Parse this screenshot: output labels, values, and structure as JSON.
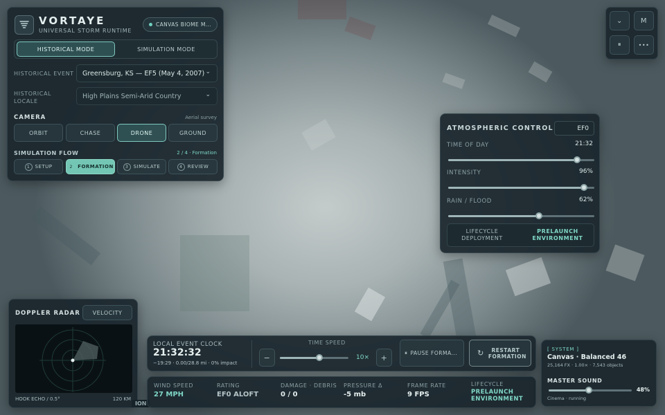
{
  "app": {
    "name": "VORTAYE",
    "subtitle": "UNIVERSAL STORM RUNTIME",
    "badge": "CANVAS BIOME M..."
  },
  "modes": {
    "historical": "HISTORICAL MODE",
    "simulation": "SIMULATION MODE"
  },
  "event": {
    "label": "HISTORICAL EVENT",
    "value": "Greensburg, KS — EF5 (May 4, 2007)"
  },
  "locale": {
    "label1": "HISTORICAL",
    "label2": "LOCALE",
    "value": "High Plains Semi-Arid Country"
  },
  "camera": {
    "title": "CAMERA",
    "hint": "Aerial survey",
    "options": [
      "ORBIT",
      "CHASE",
      "DRONE",
      "GROUND"
    ],
    "active": "DRONE"
  },
  "flow": {
    "title": "SIMULATION FLOW",
    "progress": "2 / 4 · Formation",
    "steps": [
      {
        "num": "1",
        "label": "SETUP"
      },
      {
        "num": "2",
        "label": "FORMATION"
      },
      {
        "num": "3",
        "label": "SIMULATE"
      },
      {
        "num": "4",
        "label": "REVIEW"
      }
    ],
    "active_step": "2"
  },
  "topright": {
    "collapse": "⌄",
    "m": "M",
    "pause": "⏸",
    "more": "•••"
  },
  "atmos": {
    "title": "ATMOSPHERIC CONTROL",
    "badge": "EF0",
    "time": {
      "label": "TIME OF DAY",
      "value": "21:32",
      "fraction": 0.88
    },
    "intensity": {
      "label": "INTENSITY",
      "value": "96%",
      "fraction": 0.93
    },
    "rain": {
      "label": "RAIN / FLOOD",
      "value": "62%",
      "fraction": 0.62
    },
    "lifecycle": "LIFECYCLE DEPLOYMENT",
    "prelaunch": "PRELAUNCH ENVIRONMENT"
  },
  "radar": {
    "title": "DOPPLER RADAR",
    "mode": "VELOCITY",
    "caption": "HOOK ECHO / 0.5°",
    "range": "120 KM"
  },
  "clock": {
    "label": "LOCAL EVENT CLOCK",
    "time": "21:32:32",
    "detail": "−19:29 · 0.00/28.8 mi · 0% impact"
  },
  "speed": {
    "label": "TIME SPEED",
    "value": "10×",
    "fraction": 0.58,
    "minus": "−",
    "plus": "+"
  },
  "actions": {
    "pause": "PAUSE FORMA...",
    "restart": "RESTART FORMATION"
  },
  "stats": [
    {
      "label": "WIND SPEED",
      "value": "27 MPH"
    },
    {
      "label": "RATING",
      "value": "EF0 ALOFT"
    },
    {
      "label": "DAMAGE · DEBRIS",
      "value": "0 / 0"
    },
    {
      "label": "PRESSURE Δ",
      "value": "-5 mb"
    },
    {
      "label": "FRAME RATE",
      "value": "9 FPS"
    },
    {
      "label": "LIFECYCLE",
      "value": "PRELAUNCH ENVIRONMENT"
    }
  ],
  "system": {
    "tag": "[ SYSTEM ]",
    "title": "Canvas · Balanced 46",
    "detail": "25,164 FX · 1.00× · 7,543 objects",
    "sound_label": "MASTER SOUND",
    "sound_value": "48%",
    "sound_fraction": 0.48,
    "status": "Cinema · running"
  },
  "footer_fragment": "ION"
}
